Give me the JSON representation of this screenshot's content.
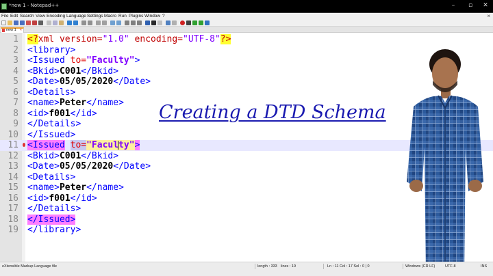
{
  "window": {
    "title": "*new 1 - Notepad++",
    "controls": [
      "minimize-icon",
      "restore-icon",
      "close-icon"
    ]
  },
  "menu": {
    "items": [
      "File",
      "Edit",
      "Search",
      "View",
      "Encoding",
      "Language",
      "Settings",
      "Macro",
      "Run",
      "Plugins",
      "Window",
      "?"
    ],
    "close_glyph": "×"
  },
  "tab": {
    "label": "new 1",
    "close_glyph": "×"
  },
  "editor": {
    "current_line": 11,
    "lines": [
      {
        "n": "1"
      },
      {
        "n": "2"
      },
      {
        "n": "3"
      },
      {
        "n": "4"
      },
      {
        "n": "5"
      },
      {
        "n": "6"
      },
      {
        "n": "7"
      },
      {
        "n": "8"
      },
      {
        "n": "9"
      },
      {
        "n": "10"
      },
      {
        "n": "11"
      },
      {
        "n": "12"
      },
      {
        "n": "13"
      },
      {
        "n": "14"
      },
      {
        "n": "15"
      },
      {
        "n": "16"
      },
      {
        "n": "17"
      },
      {
        "n": "18"
      },
      {
        "n": "19"
      }
    ],
    "tokens": {
      "l1": [
        "<?",
        "xml version=",
        "\"1.0\"",
        " encoding=",
        "\"UTF-8\"",
        "?>"
      ],
      "l2": [
        "<library>"
      ],
      "l3": [
        "<Issued ",
        "to=",
        "\"Faculty\"",
        ">"
      ],
      "l4": [
        "<Bkid>",
        "C001",
        "</Bkid>"
      ],
      "l5": [
        "<Date>",
        "05/05/2020",
        "</Date>"
      ],
      "l6": [
        "<Details>"
      ],
      "l7": [
        "<name>",
        "Peter",
        "</name>"
      ],
      "l8": [
        "<id>",
        "f001",
        "</id>"
      ],
      "l9": [
        "</Details>"
      ],
      "l10": [
        "</Issued>"
      ],
      "l11": [
        "<Issued",
        " ",
        "to=",
        "\"Facu",
        "lty\"",
        ">"
      ],
      "l12": [
        "<Bkid>",
        "C001",
        "</Bkid>"
      ],
      "l13": [
        "<Date>",
        "05/05/2020",
        "</Date>"
      ],
      "l14": [
        "<Details>"
      ],
      "l15": [
        "<name>",
        "Peter",
        "</name>"
      ],
      "l16": [
        "<id>",
        "f001",
        "</id>"
      ],
      "l17": [
        "</Details>"
      ],
      "l18": [
        "</Issued>"
      ],
      "l19": [
        "</library>"
      ]
    }
  },
  "overlay": {
    "title": "Creating a DTD Schema"
  },
  "status": {
    "filetype": "eXtensible Markup Language file",
    "length": "length : 333",
    "lines": "lines : 19",
    "position": "Ln : 11   Col : 17   Sel : 0 | 0",
    "eol": "Windows (CR LF)",
    "encoding": "UTF-8",
    "mode": "INS"
  },
  "colors": {
    "tag": "#0000ff",
    "attribute": "#e00000",
    "attr_value": "#8000ff",
    "text": "#000000",
    "overlay_title": "#1a1ab0",
    "current_line_bg": "#e8e8ff",
    "tag_highlight": "#ff7fff"
  }
}
